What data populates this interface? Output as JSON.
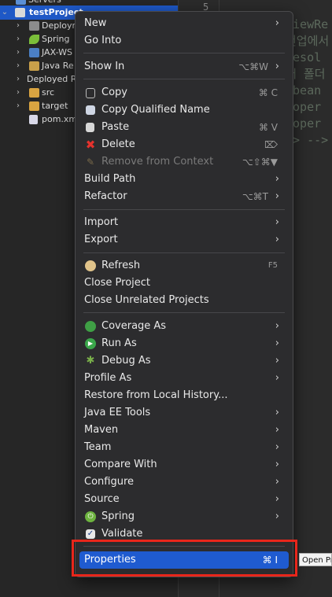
{
  "explorer": {
    "items": [
      {
        "label": "Servers"
      },
      {
        "label": "testProject"
      },
      {
        "label": "Deploym"
      },
      {
        "label": "Spring"
      },
      {
        "label": "JAX-WS"
      },
      {
        "label": "Java Re"
      },
      {
        "label": "Deployed R"
      },
      {
        "label": "src"
      },
      {
        "label": "target"
      },
      {
        "label": "pom.xm"
      }
    ]
  },
  "editor": {
    "line_number": "5",
    "lines": [
      "ViewRe",
      "컨업에서",
      "Resol",
      "배 폴더",
      "<bean",
      "roper",
      "roper",
      "n> -->"
    ]
  },
  "context_menu": {
    "new_label": "New",
    "go_into_label": "Go Into",
    "show_in_label": "Show In",
    "show_in_shortcut": "⌥⌘W",
    "copy_label": "Copy",
    "copy_shortcut": "⌘ C",
    "copy_qualified_label": "Copy Qualified Name",
    "paste_label": "Paste",
    "paste_shortcut": "⌘ V",
    "delete_label": "Delete",
    "remove_context_label": "Remove from Context",
    "remove_context_shortcut": "⌥⇧⌘▼",
    "build_path_label": "Build Path",
    "refactor_label": "Refactor",
    "refactor_shortcut": "⌥⌘T",
    "import_label": "Import",
    "export_label": "Export",
    "refresh_label": "Refresh",
    "refresh_shortcut": "F5",
    "close_project_label": "Close Project",
    "close_unrelated_label": "Close Unrelated Projects",
    "coverage_as_label": "Coverage As",
    "run_as_label": "Run As",
    "debug_as_label": "Debug As",
    "profile_as_label": "Profile As",
    "restore_history_label": "Restore from Local History...",
    "java_ee_tools_label": "Java EE Tools",
    "maven_label": "Maven",
    "team_label": "Team",
    "compare_with_label": "Compare With",
    "configure_label": "Configure",
    "source_label": "Source",
    "spring_label": "Spring",
    "validate_label": "Validate",
    "properties_label": "Properties",
    "properties_shortcut": "⌘ I"
  },
  "tooltip": {
    "text": "Open Pr"
  },
  "colors": {
    "highlight": "#1f5bd0",
    "callout": "#e8261b",
    "selection": "#1e58c6"
  }
}
